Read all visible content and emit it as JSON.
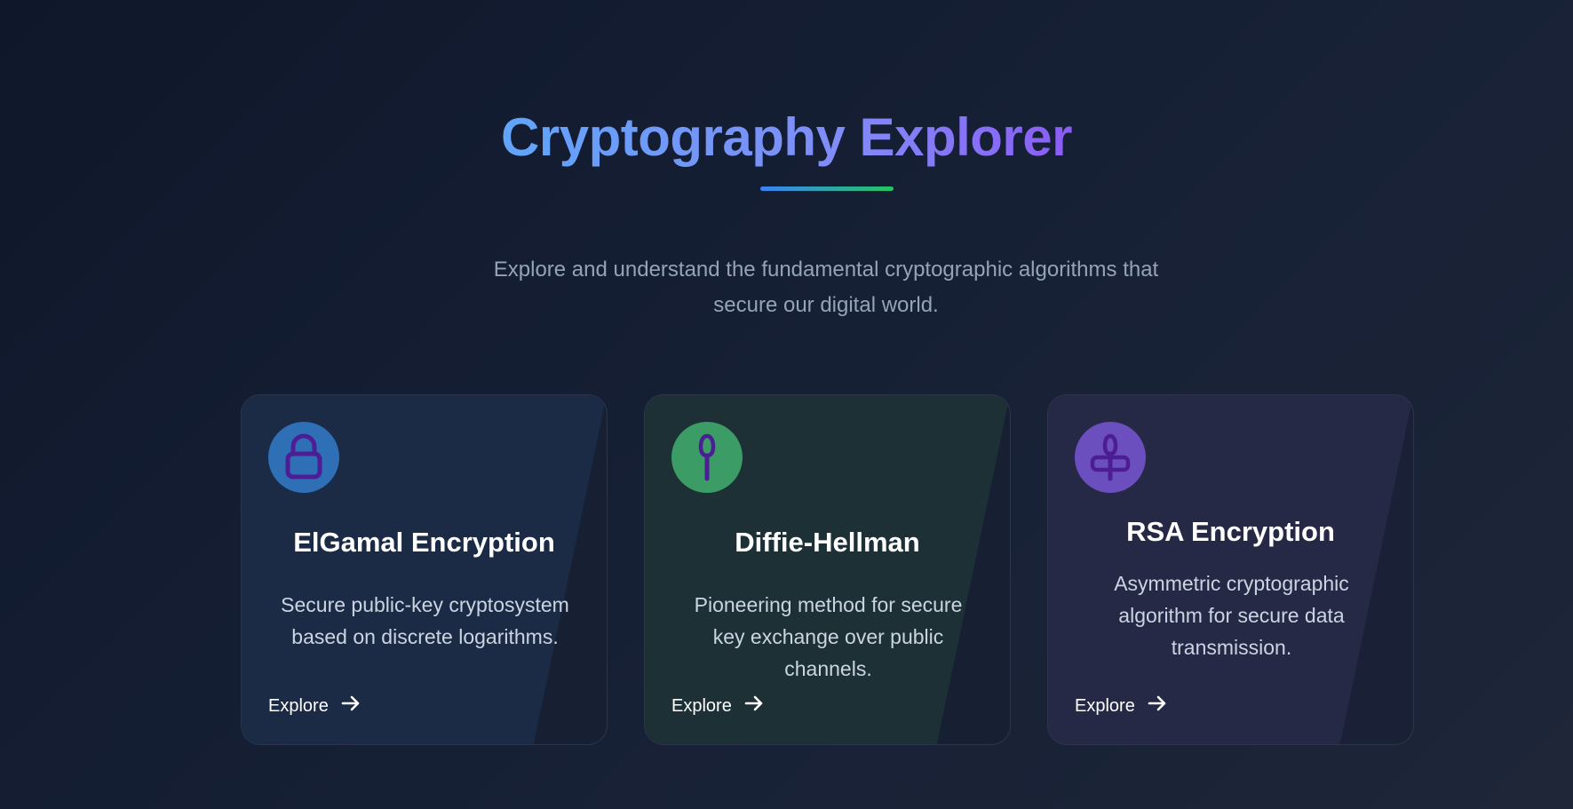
{
  "hero": {
    "title": "Cryptography Explorer",
    "subtitle": "Explore and understand the fundamental cryptographic algorithms that secure our digital world."
  },
  "cards": [
    {
      "title": "ElGamal Encryption",
      "description": "Secure public-key cryptosystem based on discrete logarithms.",
      "link_label": "Explore",
      "icon": "lock-icon",
      "accent": "#2f6fb6"
    },
    {
      "title": "Diffie-Hellman",
      "description": "Pioneering method for secure key exchange over public channels.",
      "link_label": "Explore",
      "icon": "key-icon",
      "accent": "#3b9c66"
    },
    {
      "title": "RSA Encryption",
      "description": "Asymmetric cryptographic algorithm for secure data transmission.",
      "link_label": "Explore",
      "icon": "key-alt-icon",
      "accent": "#6b4fbf"
    }
  ],
  "colors": {
    "title_gradient_start": "#60a5fa",
    "title_gradient_end": "#8b5cf6",
    "underline_start": "#3b82f6",
    "underline_end": "#22c55e",
    "icon_stroke": "#4c1d95"
  }
}
